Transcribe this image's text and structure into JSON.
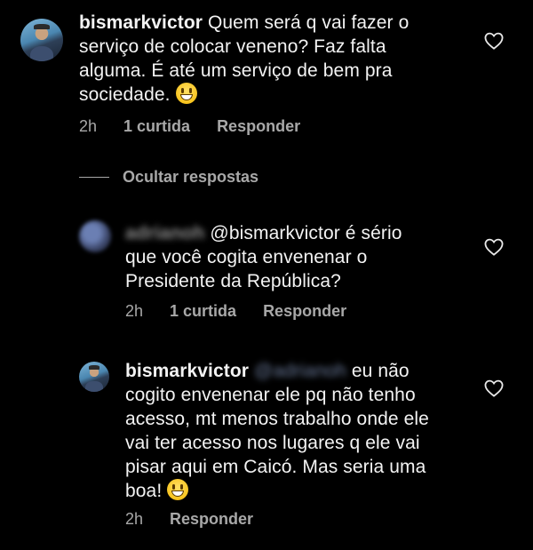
{
  "comment1": {
    "username": "bismarkvictor",
    "text_lines": [
      "Quem será q vai fazer o",
      "serviço de colocar veneno? Faz falta",
      "alguma. É até um serviço de bem pra",
      "sociedade."
    ],
    "time": "2h",
    "likes": "1 curtida",
    "reply": "Responder"
  },
  "hide_replies": "Ocultar respostas",
  "reply1": {
    "username": "adrianoh",
    "text_lines": [
      "@bismarkvictor é sério",
      "que você cogita envenenar o",
      "Presidente da República?"
    ],
    "time": "2h",
    "likes": "1 curtida",
    "reply": "Responder"
  },
  "reply2": {
    "username": "bismarkvictor",
    "mention": "@adrianoh",
    "text_lines": [
      "eu não",
      "cogito envenenar ele pq não tenho",
      "acesso, mt menos trabalho onde ele",
      "vai ter acesso nos lugares q ele vai",
      "pisar aqui em Caicó. Mas seria uma",
      "boa!"
    ],
    "time": "2h",
    "reply": "Responder"
  },
  "icons": {
    "heart": "heart-icon",
    "emoji": "grinning-face-emoji"
  }
}
